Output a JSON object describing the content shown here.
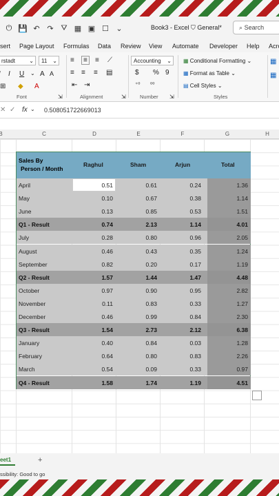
{
  "window": {
    "doc_title": "Book3 - Excel",
    "sensitivity": "General*",
    "search_placeholder": "Search"
  },
  "menu": [
    "sert",
    "Page Layout",
    "Formulas",
    "Data",
    "Review",
    "View",
    "Automate",
    "Developer",
    "Help",
    "Acro"
  ],
  "ribbon": {
    "font_name": "rstadt",
    "font_size": "11",
    "font_group": "Font",
    "alignment_group": "Alignment",
    "number_format": "Accounting",
    "number_group": "Number",
    "conditional_formatting": "Conditional Formatting",
    "format_as_table": "Format as Table",
    "cell_styles": "Cell Styles",
    "styles_group": "Styles"
  },
  "formula_bar": {
    "fx": "fx",
    "value": "0.508051722669013"
  },
  "columns": [
    "B",
    "C",
    "D",
    "E",
    "F",
    "G",
    "H"
  ],
  "table": {
    "header": {
      "label_line1": "Sales By",
      "label_line2": "Person / Month",
      "people": [
        "Raghul",
        "Sham",
        "Arjun"
      ],
      "total": "Total"
    },
    "rows": [
      {
        "label": "April",
        "values": [
          "0.51",
          "0.61",
          "0.24"
        ],
        "total": "1.36",
        "result": false
      },
      {
        "label": "May",
        "values": [
          "0.10",
          "0.67",
          "0.38"
        ],
        "total": "1.14",
        "result": false
      },
      {
        "label": "June",
        "values": [
          "0.13",
          "0.85",
          "0.53"
        ],
        "total": "1.51",
        "result": false
      },
      {
        "label": "Q1 - Result",
        "values": [
          "0.74",
          "2.13",
          "1.14"
        ],
        "total": "4.01",
        "result": true
      },
      {
        "label": "July",
        "values": [
          "0.28",
          "0.80",
          "0.96"
        ],
        "total": "2.05",
        "result": false
      },
      {
        "label": "August",
        "values": [
          "0.46",
          "0.43",
          "0.35"
        ],
        "total": "1.24",
        "result": false
      },
      {
        "label": "September",
        "values": [
          "0.82",
          "0.20",
          "0.17"
        ],
        "total": "1.19",
        "result": false
      },
      {
        "label": "Q2 - Result",
        "values": [
          "1.57",
          "1.44",
          "1.47"
        ],
        "total": "4.48",
        "result": true
      },
      {
        "label": "October",
        "values": [
          "0.97",
          "0.90",
          "0.95"
        ],
        "total": "2.82",
        "result": false
      },
      {
        "label": "November",
        "values": [
          "0.11",
          "0.83",
          "0.33"
        ],
        "total": "1.27",
        "result": false
      },
      {
        "label": "December",
        "values": [
          "0.46",
          "0.99",
          "0.84"
        ],
        "total": "2.30",
        "result": false
      },
      {
        "label": "Q3 - Result",
        "values": [
          "1.54",
          "2.73",
          "2.12"
        ],
        "total": "6.38",
        "result": true
      },
      {
        "label": "January",
        "values": [
          "0.40",
          "0.84",
          "0.03"
        ],
        "total": "1.28",
        "result": false
      },
      {
        "label": "February",
        "values": [
          "0.64",
          "0.80",
          "0.83"
        ],
        "total": "2.26",
        "result": false
      },
      {
        "label": "March",
        "values": [
          "0.54",
          "0.09",
          "0.33"
        ],
        "total": "0.97",
        "result": false
      },
      {
        "label": "Q4 - Result",
        "values": [
          "1.58",
          "1.74",
          "1.19"
        ],
        "total": "4.51",
        "result": true
      }
    ]
  },
  "sheet_tab": "eet1",
  "status": "ssibility: Good to go",
  "colors": {
    "header_fill": "#76aac4",
    "row_fill": "#c9c9c9",
    "result_fill": "#a2a2a2",
    "total_fill": "#9a9a9a",
    "table_border": "#4a8a5e"
  }
}
